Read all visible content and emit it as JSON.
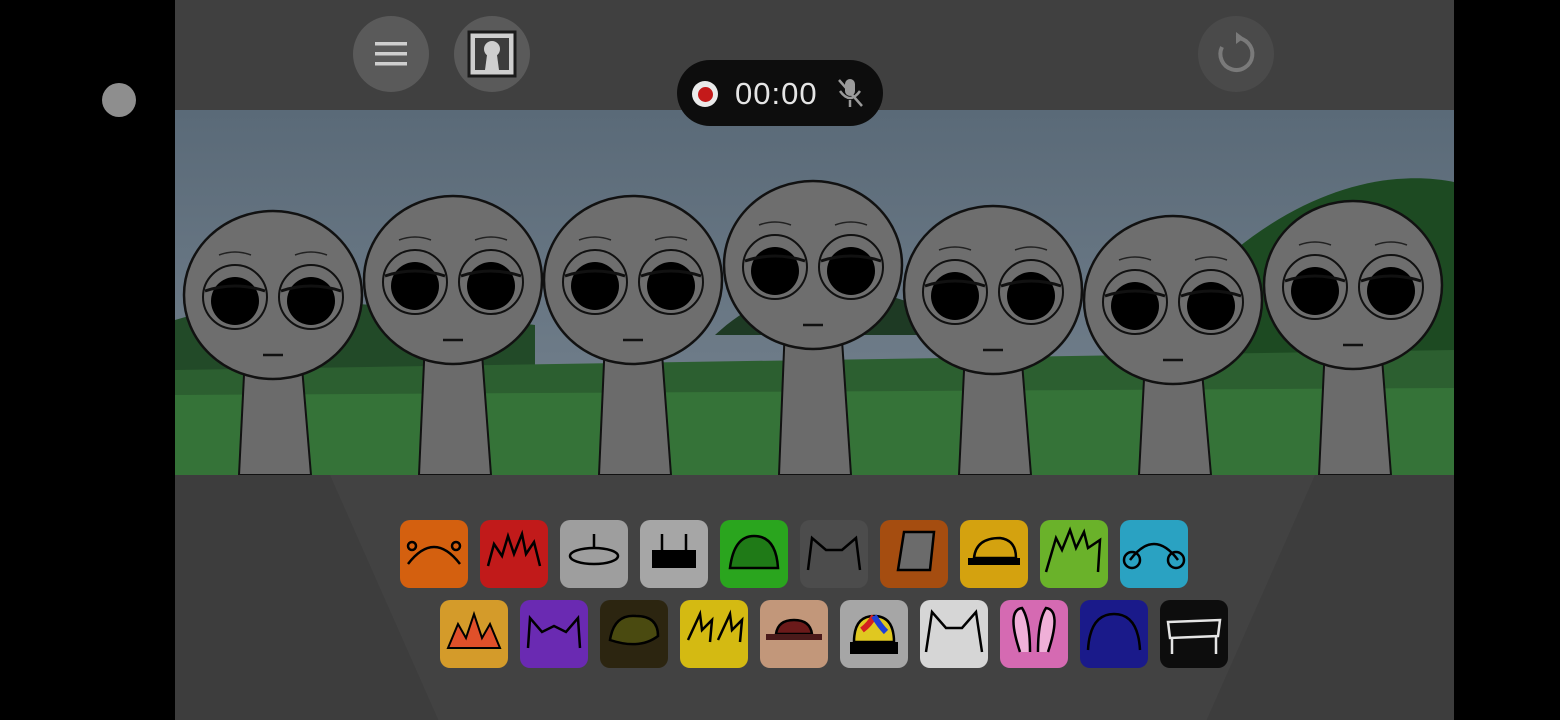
{
  "recorder": {
    "time": "00:00"
  },
  "toolbar": {
    "menu_icon": "hamburger-menu-icon",
    "photo_icon": "portrait-frame-icon",
    "reset_icon": "reload-icon",
    "record_icon": "record-dot-icon",
    "mic_icon": "mic-muted-icon"
  },
  "characters_count": 7,
  "palette": {
    "row1": [
      {
        "name": "orange-horns",
        "color": "#d4600f"
      },
      {
        "name": "red-spiky",
        "color": "#c11a1a"
      },
      {
        "name": "grey-dish",
        "color": "#9e9e9e"
      },
      {
        "name": "grey-antenna-box",
        "color": "#a6a6a6"
      },
      {
        "name": "green-helmet",
        "color": "#2aa51e"
      },
      {
        "name": "dark-grey-ears",
        "color": "#4c4c4c"
      },
      {
        "name": "brown-bucket",
        "color": "#a54d10"
      },
      {
        "name": "yellow-cap",
        "color": "#d4a20f"
      },
      {
        "name": "green-spikes",
        "color": "#6ab22a"
      },
      {
        "name": "cyan-headphones",
        "color": "#2aa2c2"
      }
    ],
    "row2": [
      {
        "name": "gold-crown-burst",
        "color": "#d49b2a"
      },
      {
        "name": "purple-horns",
        "color": "#6a2ab2"
      },
      {
        "name": "olive-hair",
        "color": "#2c2510"
      },
      {
        "name": "yellow-lightning",
        "color": "#d4ba12"
      },
      {
        "name": "tan-hat",
        "color": "#c2977a"
      },
      {
        "name": "propeller-cap",
        "color": "#a6a6a6"
      },
      {
        "name": "white-cat-ears",
        "color": "#d6d6d6"
      },
      {
        "name": "pink-bunny-ears",
        "color": "#d56ab2"
      },
      {
        "name": "navy-dome",
        "color": "#1a1a8a"
      },
      {
        "name": "black-frame",
        "color": "#0d0d0d"
      }
    ]
  }
}
